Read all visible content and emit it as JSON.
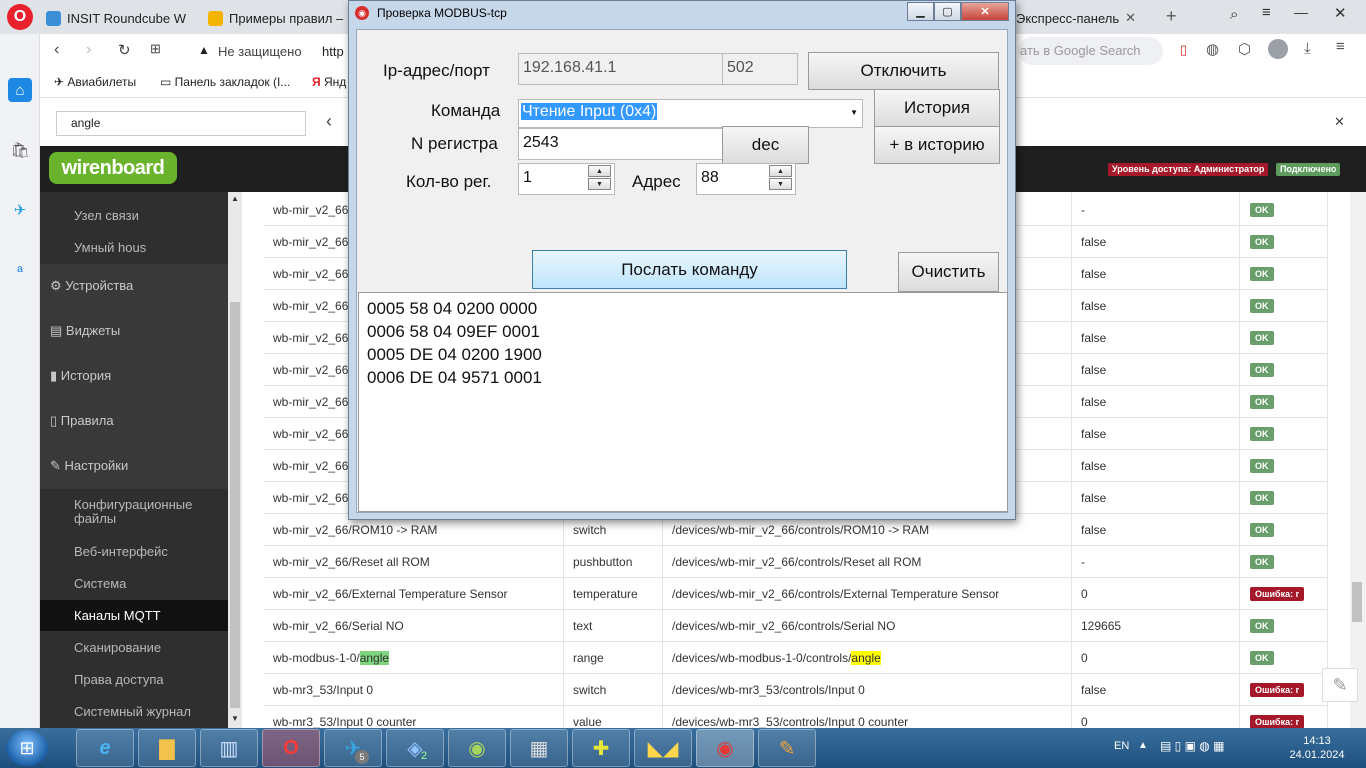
{
  "browser": {
    "tabs": [
      {
        "title": "INSIT Roundcube W",
        "favicon_color": "#3a8fd6"
      },
      {
        "title": "Примеры правил –",
        "favicon_color": "#f4b400"
      },
      {
        "title": "Экспресс-панель",
        "favicon_color": "#e8212c"
      }
    ],
    "not_secure": "Не защищено",
    "url_partial": "http",
    "search_placeholder": "ать в Google Search",
    "bookmarks": [
      "Авиабилеты",
      "Панель закладок (I...",
      "Янд"
    ],
    "find_value": "angle"
  },
  "app": {
    "logo": "wirenboard",
    "access_badge": "Уровень доступа: Администратор",
    "connected_badge": "Подключено",
    "nav": [
      {
        "label": "Узел связи",
        "kind": "sub"
      },
      {
        "label": "Умный hous",
        "kind": "sub"
      },
      {
        "label": "Устройства",
        "kind": "top",
        "icon": "⚙"
      },
      {
        "label": "Виджеты",
        "kind": "top",
        "icon": "▤"
      },
      {
        "label": "История",
        "kind": "top",
        "icon": "▮"
      },
      {
        "label": "Правила",
        "kind": "top",
        "icon": "▯"
      },
      {
        "label": "Настройки",
        "kind": "top",
        "icon": "🔧"
      },
      {
        "label": "Конфигурационные файлы",
        "kind": "sub"
      },
      {
        "label": "Веб-интерфейс",
        "kind": "sub"
      },
      {
        "label": "Система",
        "kind": "sub"
      },
      {
        "label": "Каналы MQTT",
        "kind": "sub",
        "active": true
      },
      {
        "label": "Сканирование",
        "kind": "sub"
      },
      {
        "label": "Права доступа",
        "kind": "sub"
      },
      {
        "label": "Системный журнал",
        "kind": "sub"
      }
    ],
    "rows": [
      {
        "name": "wb-mir_v2_66",
        "type": "",
        "topic": "",
        "value": "-",
        "status": "OK"
      },
      {
        "name": "wb-mir_v2_66",
        "type": "",
        "topic": "",
        "value": "false",
        "status": "OK"
      },
      {
        "name": "wb-mir_v2_66",
        "type": "",
        "topic": "",
        "value": "false",
        "status": "OK"
      },
      {
        "name": "wb-mir_v2_66",
        "type": "",
        "topic": "",
        "value": "false",
        "status": "OK"
      },
      {
        "name": "wb-mir_v2_66",
        "type": "",
        "topic": "",
        "value": "false",
        "status": "OK"
      },
      {
        "name": "wb-mir_v2_66",
        "type": "",
        "topic": "",
        "value": "false",
        "status": "OK"
      },
      {
        "name": "wb-mir_v2_66",
        "type": "",
        "topic": "",
        "value": "false",
        "status": "OK"
      },
      {
        "name": "wb-mir_v2_66",
        "type": "",
        "topic": "",
        "value": "false",
        "status": "OK"
      },
      {
        "name": "wb-mir_v2_66",
        "type": "",
        "topic": "",
        "value": "false",
        "status": "OK"
      },
      {
        "name": "wb-mir_v2_66",
        "type": "",
        "topic": "",
        "value": "false",
        "status": "OK"
      },
      {
        "name": "wb-mir_v2_66/ROM10 -> RAM",
        "type": "switch",
        "topic": "/devices/wb-mir_v2_66/controls/ROM10 -> RAM",
        "value": "false",
        "status": "OK"
      },
      {
        "name": "wb-mir_v2_66/Reset all ROM",
        "type": "pushbutton",
        "topic": "/devices/wb-mir_v2_66/controls/Reset all ROM",
        "value": "-",
        "status": "OK"
      },
      {
        "name": "wb-mir_v2_66/External Temperature Sensor",
        "type": "temperature",
        "topic": "/devices/wb-mir_v2_66/controls/External Temperature Sensor",
        "value": "0",
        "status": "Ошибка: r"
      },
      {
        "name": "wb-mir_v2_66/Serial NO",
        "type": "text",
        "topic": "/devices/wb-mir_v2_66/controls/Serial NO",
        "value": "129665",
        "status": "OK"
      },
      {
        "name": "wb-modbus-1-0/",
        "name_hl": "angle",
        "type": "range",
        "topic": "/devices/wb-modbus-1-0/controls/",
        "topic_hl": "angle",
        "value": "0",
        "status": "OK"
      },
      {
        "name": "wb-mr3_53/Input 0",
        "type": "switch",
        "topic": "/devices/wb-mr3_53/controls/Input 0",
        "value": "false",
        "status": "Ошибка: r"
      },
      {
        "name": "wb-mr3_53/Input 0 counter",
        "type": "value",
        "topic": "/devices/wb-mr3_53/controls/Input 0 counter",
        "value": "0",
        "status": "Ошибка: r"
      }
    ]
  },
  "dialog": {
    "title": "Проверка MODBUS-tcp",
    "ip_label": "Ip-адрес/порт",
    "ip_value": "192.168.41.1",
    "port_value": "502",
    "disconnect_label": "Отключить",
    "command_label": "Команда",
    "command_value": "Чтение Input (0x4)",
    "history_label": "История",
    "register_label": "N регистра",
    "register_value": "2543",
    "dec_label": "dec",
    "add_history_label": "+ в историю",
    "count_label": "Кол-во рег.",
    "count_value": "1",
    "address_label": "Адрес",
    "address_value": "88",
    "send_label": "Послать команду",
    "clear_label": "Очистить",
    "log": [
      "0005 58 04 0200 0000",
      "0006 58 04 09EF 0001",
      "0005 DE 04 0200 1900",
      "0006 DE 04 9571 0001"
    ]
  },
  "taskbar": {
    "language": "EN",
    "time": "14:13",
    "date": "24.01.2024",
    "telegram_badge": "5",
    "app2_badge": "2"
  }
}
